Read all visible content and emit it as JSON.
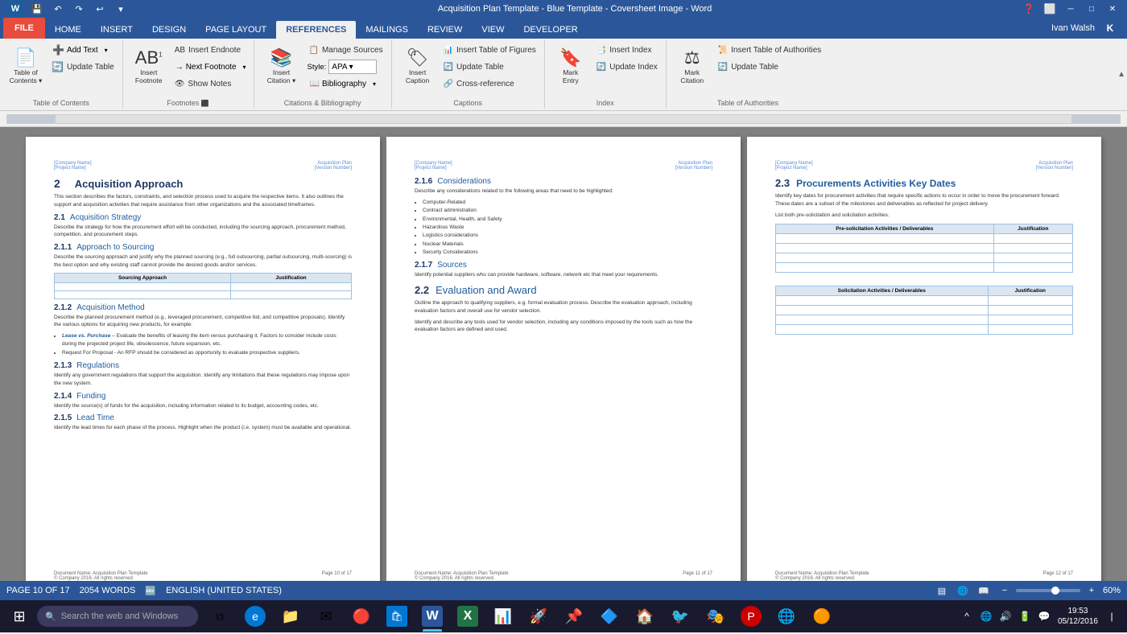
{
  "titlebar": {
    "title": "Acquisition Plan Template - Blue Template - Coversheet Image - Word",
    "quick_access": [
      "save",
      "undo",
      "redo",
      "repeat",
      "customize"
    ]
  },
  "ribbon": {
    "tabs": [
      "FILE",
      "HOME",
      "INSERT",
      "DESIGN",
      "PAGE LAYOUT",
      "REFERENCES",
      "MAILINGS",
      "REVIEW",
      "VIEW",
      "DEVELOPER"
    ],
    "active_tab": "REFERENCES",
    "groups": [
      {
        "name": "Table of Contents",
        "items": [
          {
            "label": "Table of\nContents",
            "type": "large",
            "icon": "📄"
          },
          {
            "label": "Add Text",
            "type": "small-split"
          },
          {
            "label": "Update Table",
            "type": "small"
          }
        ]
      },
      {
        "name": "Footnotes",
        "items": [
          {
            "label": "Insert\nFootnote",
            "type": "large",
            "icon": "📝"
          },
          {
            "label": "Insert Endnote",
            "type": "small"
          },
          {
            "label": "Next Footnote",
            "type": "small-split"
          },
          {
            "label": "Show Notes",
            "type": "small"
          }
        ]
      },
      {
        "name": "Citations & Bibliography",
        "items": [
          {
            "label": "Insert\nCitation",
            "type": "large-split",
            "icon": "📚"
          },
          {
            "label": "Manage Sources",
            "type": "small"
          },
          {
            "label": "Style: APA",
            "type": "combo"
          },
          {
            "label": "Bibliography",
            "type": "small-split"
          }
        ]
      },
      {
        "name": "Captions",
        "items": [
          {
            "label": "Insert\nCaption",
            "type": "large",
            "icon": "🏷"
          },
          {
            "label": "Insert Table of Figures",
            "type": "small"
          },
          {
            "label": "Update Table",
            "type": "small"
          },
          {
            "label": "Cross-reference",
            "type": "small"
          }
        ]
      },
      {
        "name": "Index",
        "items": [
          {
            "label": "Mark\nEntry",
            "type": "large",
            "icon": "🔖"
          },
          {
            "label": "Insert Index",
            "type": "small"
          },
          {
            "label": "Update Index",
            "type": "small"
          }
        ]
      },
      {
        "name": "Table of Authorities",
        "items": [
          {
            "label": "Mark\nCitation",
            "type": "large",
            "icon": "⚖"
          },
          {
            "label": "Insert Table of Authorities",
            "type": "small"
          },
          {
            "label": "Update Table",
            "type": "small"
          }
        ]
      }
    ]
  },
  "pages": [
    {
      "id": "page10",
      "header_left": "[Company Name]\n[Project Name]",
      "header_right": "Acquisition Plan\n[Version Number]",
      "section_main": "2",
      "section_main_title": "Acquisition Approach",
      "section_body": "This section describes the factors, constraints, and selection process used to acquire the respective items. It also outlines the support and acquisition activities that require assistance from other organizations and the associated timeframes.",
      "subsections": [
        {
          "num": "2.1",
          "title": "Acquisition Strategy",
          "body": "Describe the strategy for how the procurement effort will be conducted, including the sourcing approach, procurement method, competition, and procurement steps."
        },
        {
          "num": "2.1.1",
          "title": "Approach to Sourcing",
          "body": "Describe the sourcing approach and justify why the planned sourcing (e.g., full outsourcing, partial outsourcing, multi-sourcing) is the best option and why existing staff cannot provide the desired goods and/or services.",
          "has_table": true,
          "table_cols": [
            "Sourcing Approach",
            "Justification"
          ]
        },
        {
          "num": "2.1.2",
          "title": "Acquisition Method",
          "body": "Describe the planned procurement method (e.g., leveraged procurement, competitive bid, and competitive proposals). Identify the various options for acquiring new products, for example:",
          "bullets": [
            "Lease vs. Purchase – Evaluate the benefits of leasing the item versus purchasing it. Factors to consider include costs during the projected project life, obsolescence, future expansion, etc.",
            "Request For Proposal - An RFP should be considered as opportunity to evaluate prospective suppliers."
          ]
        },
        {
          "num": "2.1.3",
          "title": "Regulations",
          "body": "Identify any government regulations that support the acquisition. Identify any limitations that these regulations may impose upon the new system."
        },
        {
          "num": "2.1.4",
          "title": "Funding",
          "body": "Identify the source(s) of funds for the acquisition, including information related to its budget, accounting codes, etc."
        },
        {
          "num": "2.1.5",
          "title": "Lead Time",
          "body": "Identify the lead times for each phase of the process. Highlight when the product (i.e. system) must be available and operational."
        }
      ],
      "footer_left": "Document Name: Acquisition Plan Template\n© Company 2016. All rights reserved.",
      "footer_right": "Page 10 of 17"
    },
    {
      "id": "page11",
      "header_left": "[Company Name]\n[Project Name]",
      "header_right": "Acquisition Plan\n[Version Number]",
      "subsections": [
        {
          "num": "2.1.6",
          "title": "Considerations",
          "body": "Describe any considerations related to the following areas that need to be highlighted:",
          "bullets": [
            "Computer-Related",
            "Contract administration",
            "Environmental, Health, and Safety",
            "Hazardous Waste",
            "Logistics considerations",
            "Nuclear Materials",
            "Security Considerations"
          ]
        },
        {
          "num": "2.1.7",
          "title": "Sources",
          "body": "Identify potential suppliers who can provide hardware, software, network etc that meet your requirements."
        },
        {
          "num": "2.2",
          "title": "Evaluation and Award",
          "body": "Outline the approach to qualifying suppliers, e.g. formal evaluation process. Describe the evaluation approach, including evaluation factors and overall use for vendor selection.\n\nIdentify and describe any tools used for vendor selection, including any conditions imposed by the tools such as how the evaluation factors are defined and used."
        }
      ],
      "footer_center": "Document Name: Acquisition Plan Template\n© Company 2016. All rights reserved.",
      "footer_right": "Page 11 of 17"
    },
    {
      "id": "page12",
      "header_left": "[Company Name]\n[Project Name]",
      "header_right": "Acquisition Plan\n[Version Number]",
      "subsections": [
        {
          "num": "2.3",
          "title": "Procurements Activities Key Dates",
          "body": "Identify key dates for procurement activities that require specific actions to occur in order to move the procurement forward. These dates are a subset of the milestones and deliverables as reflected for project delivery.\n\nList both pre-solicitation and solicitation activities.",
          "has_table1": true,
          "table1_cols": [
            "Pre-solicitation Activities / Deliverables",
            "Justification"
          ],
          "has_table2": true,
          "table2_cols": [
            "Solicitation Activities / Deliverables",
            "Justification"
          ]
        }
      ],
      "footer_left": "Document Name: Acquisition Plan Template\n© Company 2016. All rights reserved.",
      "footer_right": "Page 12 of 17"
    }
  ],
  "status": {
    "page": "PAGE 10 OF 17",
    "words": "2054 WORDS",
    "language": "ENGLISH (UNITED STATES)"
  },
  "taskbar": {
    "search_placeholder": "Search the web and Windows",
    "time": "19:53",
    "date": "05/12/2016",
    "apps": [
      "⊞",
      "🌐",
      "📁",
      "📧",
      "🔴",
      "📦",
      "W",
      "X",
      "📊",
      "🚀",
      "📌",
      "🔷",
      "🏠",
      "🐦",
      "🎭",
      "🔴",
      "🌐",
      "🟠"
    ]
  },
  "user": {
    "name": "Ivan Walsh",
    "initial": "K"
  },
  "zoom": {
    "level": "60%",
    "value": 60
  }
}
